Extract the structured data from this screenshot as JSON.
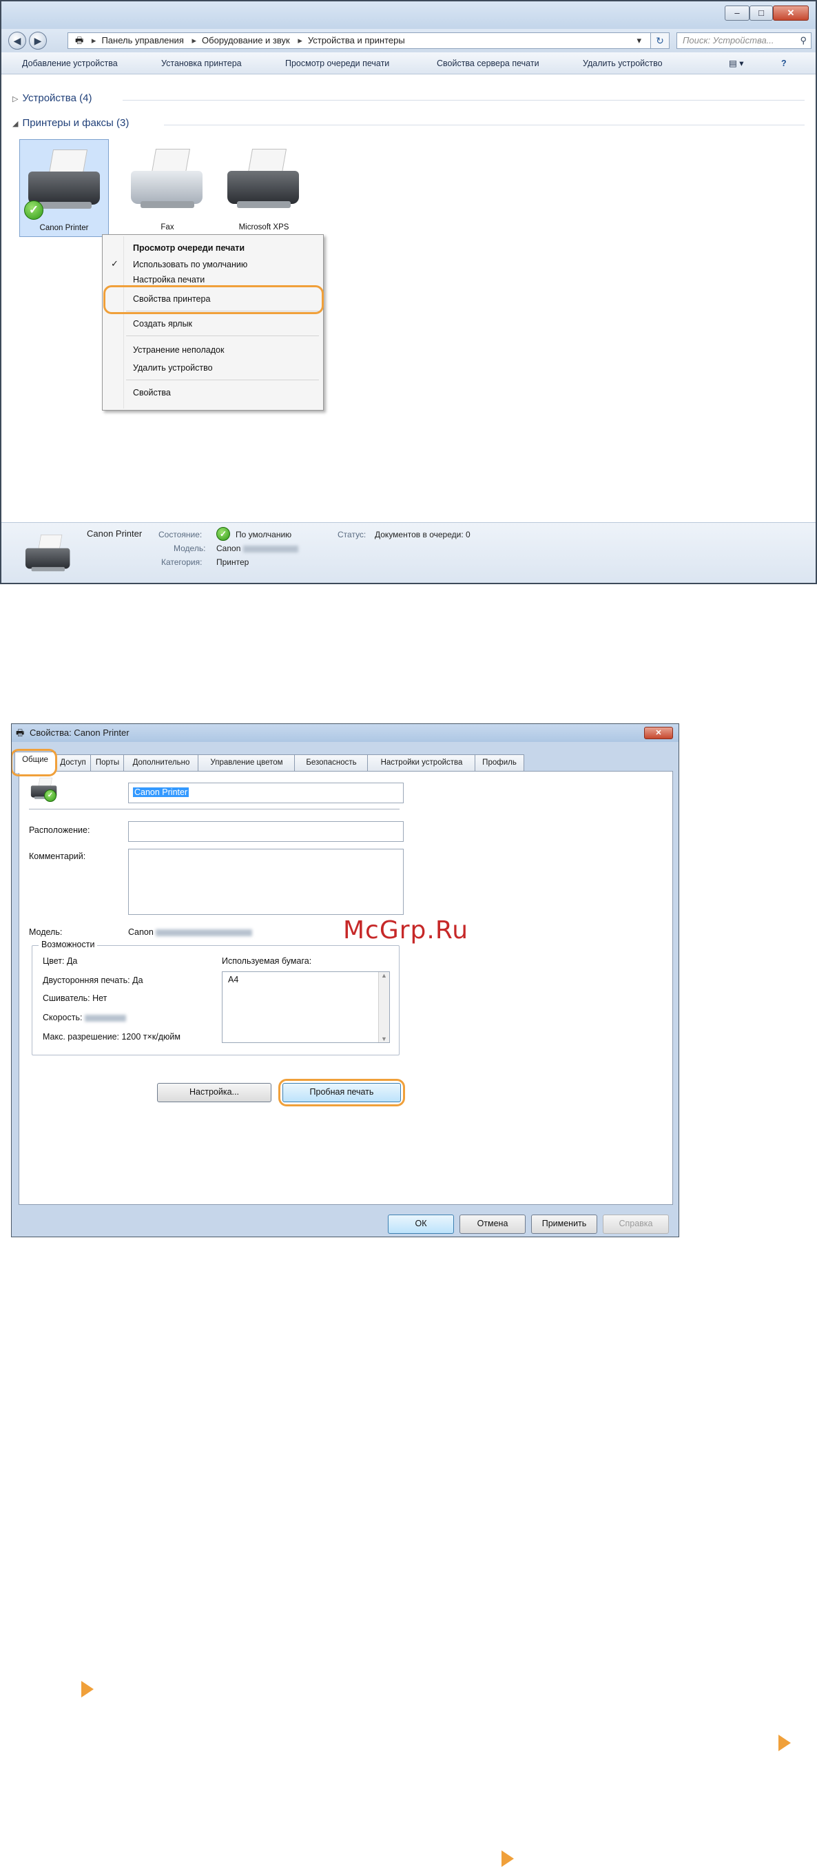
{
  "window1": {
    "title_buttons": [
      "–",
      "□",
      "✕"
    ],
    "breadcrumb": [
      "Панель управления",
      "Оборудование и звук",
      "Устройства и принтеры"
    ],
    "search_placeholder": "Поиск: Устройства...",
    "toolbar": [
      "Добавление устройства",
      "Установка принтера",
      "Просмотр очереди печати",
      "Свойства сервера печати",
      "Удалить устройство"
    ],
    "group_devices": "Устройства (4)",
    "group_printers": "Принтеры и факсы (3)",
    "printers": [
      {
        "label": "Canon Printer",
        "selected": true,
        "default": true
      },
      {
        "label": "Fax",
        "selected": false
      },
      {
        "label": "Microsoft XPS",
        "selected": false
      }
    ],
    "context_menu": [
      {
        "label": "Просмотр очереди печати",
        "bold": true
      },
      {
        "label": "Использовать по умолчанию",
        "checked": true
      },
      {
        "label": "Настройка печати"
      },
      {
        "label": "Свойства принтера",
        "highlighted": true
      },
      {
        "label": "Создать ярлык"
      },
      {
        "label": "Устранение неполадок"
      },
      {
        "label": "Удалить устройство"
      },
      {
        "label": "Свойства"
      }
    ],
    "details": {
      "name": "Canon Printer",
      "state_label": "Состояние:",
      "state_value": "По умолчанию",
      "status_label": "Статус:",
      "status_value": "Документов в очереди: 0",
      "model_label": "Модель:",
      "model_value": "Canon",
      "category_label": "Категория:",
      "category_value": "Принтер"
    }
  },
  "window2": {
    "title": "Свойства: Canon Printer",
    "tabs": [
      "Общие",
      "Доступ",
      "Порты",
      "Дополнительно",
      "Управление цветом",
      "Безопасность",
      "Настройки устройства",
      "Профиль"
    ],
    "printer_name": "Canon Printer",
    "location_label": "Расположение:",
    "comment_label": "Комментарий:",
    "model_label": "Модель:",
    "model_value": "Canon",
    "features_label": "Возможности",
    "color": "Цвет: Да",
    "duplex": "Двусторонняя печать: Да",
    "staple": "Сшиватель: Нет",
    "speed": "Скорость:",
    "resolution": "Макс. разрешение: 1200 т×к/дюйм",
    "paper_label": "Используемая бумага:",
    "paper_list": [
      "A4"
    ],
    "btn_settings": "Настройка...",
    "btn_testpage": "Пробная печать",
    "btn_ok": "ОК",
    "btn_cancel": "Отмена",
    "btn_apply": "Применить",
    "btn_help": "Справка"
  },
  "watermark": "McGrp.Ru",
  "accent_color": "#f0a03a"
}
